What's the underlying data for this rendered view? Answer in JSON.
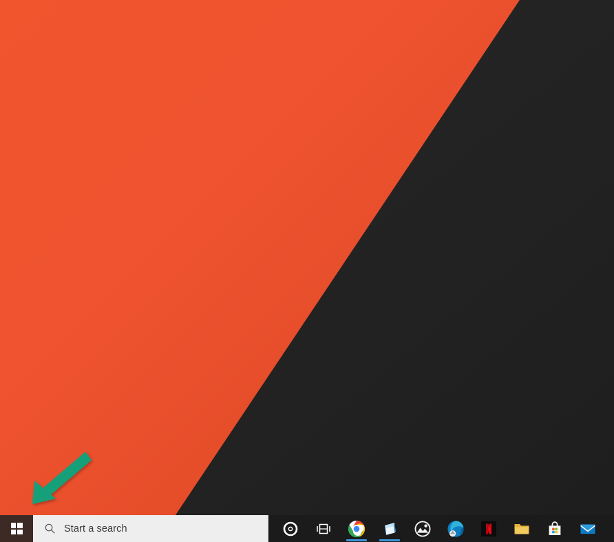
{
  "desktop": {
    "wallpaper": {
      "name": "diagonal-split-wallpaper",
      "orange_color": "#EF5330",
      "dark_color": "#232323",
      "description": "Diagonal split orange and dark charcoal"
    },
    "annotation": {
      "type": "arrow",
      "color": "#17A07A",
      "points_to": "start-button",
      "direction": "down-left"
    }
  },
  "taskbar": {
    "background_color": "#1B1B1B",
    "start": {
      "label": "Start",
      "icon": "windows-logo-icon",
      "highlight_color": "#3D2A24",
      "state": "hover"
    },
    "search": {
      "placeholder": "Start a search",
      "value": "",
      "icon": "search-icon",
      "background_color": "#EEEEEE",
      "text_color": "#3A3A3A"
    },
    "items": [
      {
        "label": "Cortana",
        "icon": "cortana-circle-icon",
        "running": false
      },
      {
        "label": "Task View",
        "icon": "task-view-icon",
        "running": false
      },
      {
        "label": "Google Chrome",
        "icon": "chrome-icon",
        "running": true
      },
      {
        "label": "Paint 3D",
        "icon": "paint3d-icon",
        "running": true
      },
      {
        "label": "Photos",
        "icon": "photos-icon",
        "running": false
      },
      {
        "label": "Microsoft Edge",
        "icon": "edge-icon",
        "running": false
      },
      {
        "label": "Netflix",
        "icon": "netflix-icon",
        "running": false
      },
      {
        "label": "File Explorer",
        "icon": "file-explorer-icon",
        "running": false
      },
      {
        "label": "Microsoft Store",
        "icon": "microsoft-store-icon",
        "running": false
      },
      {
        "label": "Mail",
        "icon": "mail-icon",
        "running": false
      }
    ],
    "running_indicator_color": "#3A93D6"
  }
}
